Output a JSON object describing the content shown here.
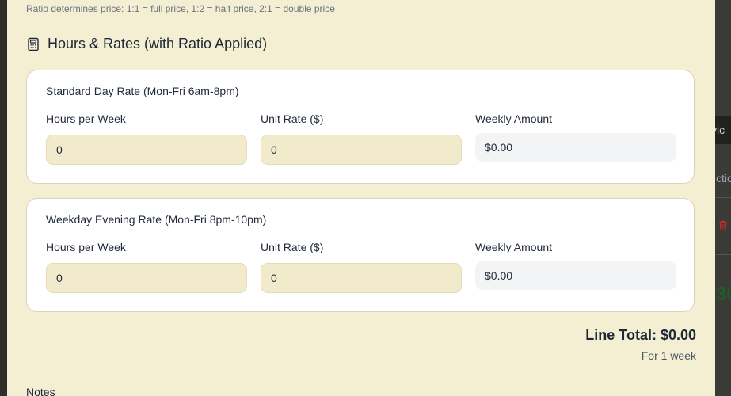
{
  "hint": "Ratio determines price: 1:1 = full price, 1:2 = half price, 2:1 = double price",
  "section": {
    "title": "Hours & Rates (with Ratio Applied)",
    "icon": "calculator-icon"
  },
  "rates": [
    {
      "title": "Standard Day Rate (Mon-Fri 6am-8pm)",
      "hours_label": "Hours per Week",
      "hours_value": "0",
      "rate_label": "Unit Rate ($)",
      "rate_value": "0",
      "amount_label": "Weekly Amount",
      "amount_value": "$0.00"
    },
    {
      "title": "Weekday Evening Rate (Mon-Fri 8pm-10pm)",
      "hours_label": "Hours per Week",
      "hours_value": "0",
      "rate_label": "Unit Rate ($)",
      "rate_value": "0",
      "amount_label": "Weekly Amount",
      "amount_value": "$0.00"
    }
  ],
  "totals": {
    "line_total": "Line Total: $0.00",
    "duration": "For 1 week"
  },
  "notes_label": "Notes",
  "background": {
    "button_fragment": "vic",
    "header_fragment": "ctic",
    "total_fragment": "30"
  },
  "colors": {
    "modal_bg": "#f4efd3",
    "input_bg": "#f1ebcc",
    "card_bg": "#ffffff",
    "text": "#1f2937",
    "muted": "#6b7280",
    "danger": "#dc2626",
    "success": "#1f5c2a"
  }
}
